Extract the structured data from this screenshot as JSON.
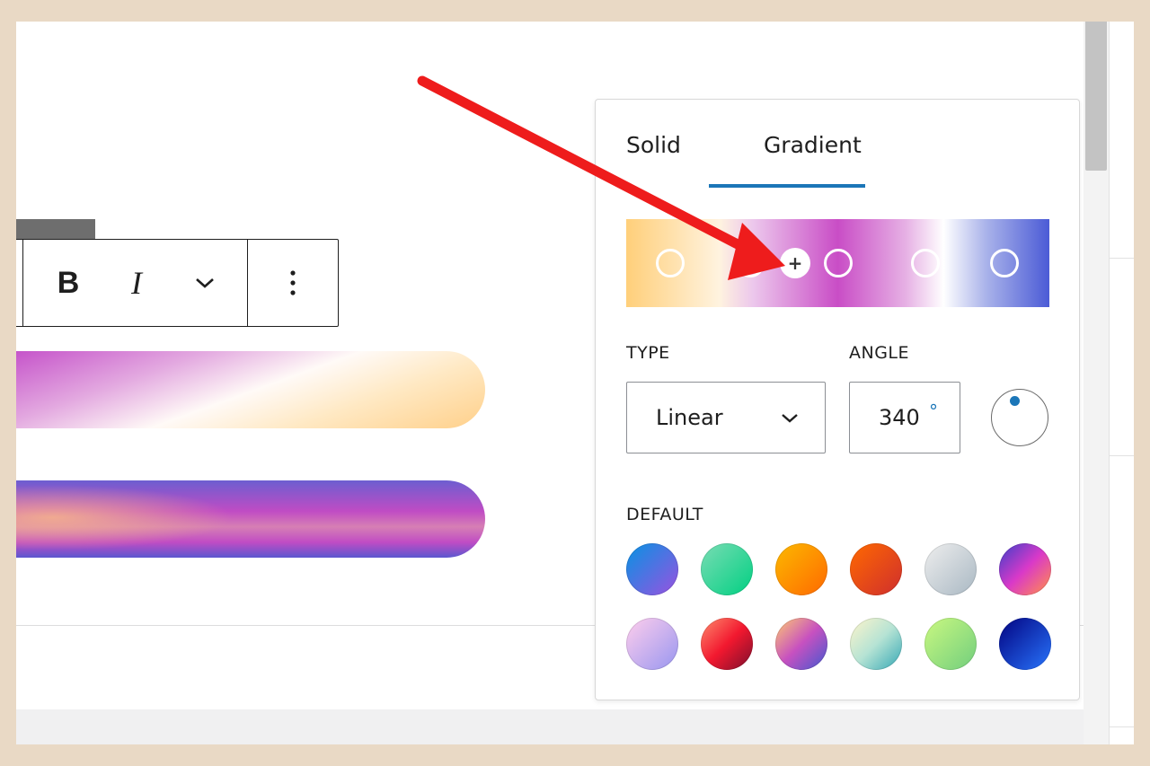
{
  "toolbar": {
    "bold_label": "B",
    "italic_label": "I",
    "more_label": "⋮"
  },
  "popover": {
    "tabs": [
      {
        "label": "Solid",
        "active": false
      },
      {
        "label": "Gradient",
        "active": true
      }
    ],
    "type_label": "TYPE",
    "type_value": "Linear",
    "angle_label": "ANGLE",
    "angle_value": "340",
    "angle_unit": "°",
    "default_label": "DEFAULT",
    "insert_stop_label": "+"
  },
  "colors": {
    "accent": "#1b76b8",
    "annotation_arrow": "#ee1c1c"
  },
  "icons": {
    "chevron": "chevron-down-icon",
    "more": "more-vertical-icon",
    "plus": "plus-icon"
  }
}
